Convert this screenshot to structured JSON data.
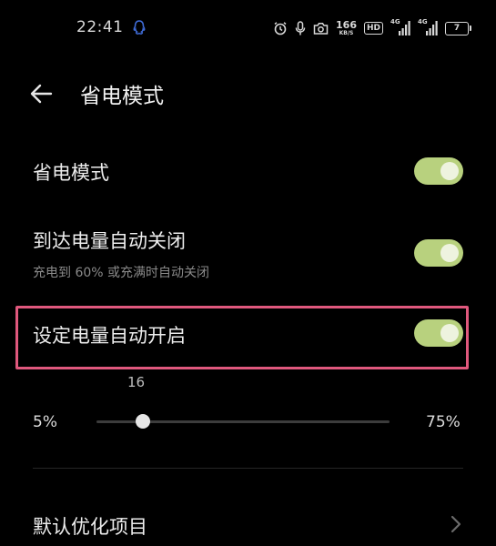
{
  "status_bar": {
    "time": "22:41",
    "net_speed_value": "166",
    "net_speed_unit": "KB/S",
    "hd_label": "HD",
    "signal1_tag": "4G",
    "signal2_tag": "4G",
    "battery_level": "7",
    "icons": [
      "qq-icon",
      "alarm-icon",
      "mic-icon",
      "camera-icon",
      "signal-icon",
      "battery-icon"
    ]
  },
  "header": {
    "back_icon": "back-arrow-icon",
    "title": "省电模式"
  },
  "settings": {
    "power_saving": {
      "label": "省电模式",
      "enabled": true
    },
    "auto_close": {
      "label": "到达电量自动关闭",
      "sublabel": "充电到 60% 或充满时自动关闭",
      "enabled": true
    },
    "auto_enable": {
      "label": "设定电量自动开启",
      "enabled": true
    }
  },
  "threshold_slider": {
    "value": "16",
    "min_label": "5%",
    "max_label": "75%",
    "min": 5,
    "max": 75
  },
  "default_optimization": {
    "label": "默认优化项目",
    "icon": "chevron-right-icon"
  },
  "colors": {
    "background": "#000000",
    "toggle_on": "#b8d17e",
    "highlight": "#e0587d",
    "accent_qq": "#3f6bd6"
  }
}
